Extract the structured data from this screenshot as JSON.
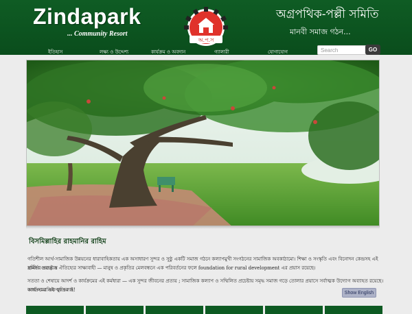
{
  "header": {
    "logo_title": "Zindapark",
    "logo_subtitle": "... Community Resort",
    "org_name": "অগ্রপথিক-পল্লী সমিতি",
    "org_motto": "মানবী সমাজ গঠন...",
    "emblem_caption": "অ.প.স"
  },
  "nav": {
    "items": [
      {
        "label": "ইতিহাস"
      },
      {
        "label": "লক্ষ্য ও উদ্দেশ্য"
      },
      {
        "label": "কার্যক্রম ও অবদান"
      },
      {
        "label": "গ্যালারী"
      },
      {
        "label": "যোগাযোগ"
      }
    ]
  },
  "search": {
    "placeholder": "Search",
    "button_label": "GO"
  },
  "content": {
    "section_title": "বিসমিল্লাহির রাহমানির রাহিম",
    "paragraphs": [
      "গতিশীল আর্থ-সামাজিক উন্নয়নের ধারাবাহিকতায় এক অসাধারণ সুন্দর ও সুষ্ঠু একটি সমাজ গঠনে কল্যাণমুখী সংগঠনের সামাজিক অবকাঠামো। শিক্ষা ও সংস্কৃতি এবং বিনোদন কেন্দ্রসহ এই স্বনির্ভর প্রচেষ্টায়",
      "গ্রামীণ গুরুত্ব ও ঐতিহ্যের সাক্ষ্যবাহী — মানুষ ও প্রকৃতির মেলবন্ধনে এক পরিবর্তনের ফলে foundation for rural development এর প্রয়াস রয়েছে।",
      "সততা ও শেষায়ে আদর্শ ও কার্যক্রমের এই কর্মধারা — এক সুন্দর জীবনের প্রত্যয় ; সামাজিক কল্যাণ ও সম্মিলিত প্রচেষ্টায় সমৃদ্ধ সমাজ গড়ে তোলার প্রয়াসে সর্বাত্মক উদ্যোগ অব্যাহত রয়েছে। আর্থ-সামাজিক মুক্তির ও",
      "কার্যক্রমের এই পথ চলাই!"
    ],
    "show_english_label": "Show English"
  },
  "colors": {
    "header_green": "#0f5c24",
    "emblem_red": "#e0322b",
    "title_green": "#0b3b12",
    "button_blue": "#aeb3c8"
  },
  "icons": {
    "emblem": "organization-emblem-icon"
  }
}
